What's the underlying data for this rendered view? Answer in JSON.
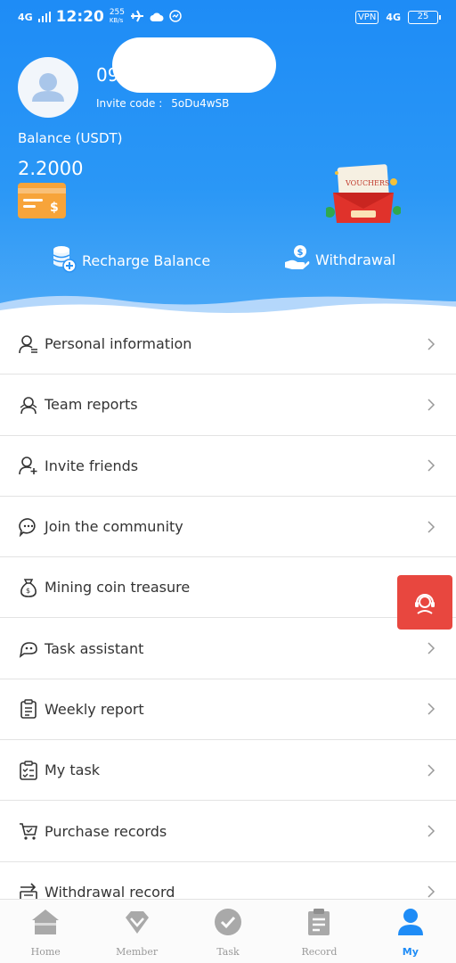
{
  "status_bar": {
    "network": "4G",
    "time": "12:20",
    "speed": "255",
    "speed_unit": "KB/s",
    "vpn": "VPN",
    "network_right": "4G",
    "battery": "25"
  },
  "profile": {
    "username": "09",
    "invite_label": "Invite code :",
    "invite_code": "5oDu4wSB"
  },
  "balance": {
    "label": "Balance (USDT)",
    "value": "2.2000"
  },
  "voucher": {
    "label": "VOUCHERS"
  },
  "actions": {
    "recharge": "Recharge Balance",
    "withdraw": "Withdrawal"
  },
  "menu": {
    "items": [
      {
        "label": "Personal information",
        "icon": "person-info-icon"
      },
      {
        "label": "Team reports",
        "icon": "team-icon"
      },
      {
        "label": "Invite friends",
        "icon": "add-user-icon"
      },
      {
        "label": "Join the community",
        "icon": "chat-icon"
      },
      {
        "label": "Mining coin treasure",
        "icon": "money-bag-icon"
      },
      {
        "label": "Task assistant",
        "icon": "assistant-icon"
      },
      {
        "label": "Weekly report",
        "icon": "report-icon"
      },
      {
        "label": "My task",
        "icon": "checklist-icon"
      },
      {
        "label": "Purchase records",
        "icon": "cart-icon"
      },
      {
        "label": "Withdrawal record",
        "icon": "withdraw-record-icon"
      }
    ]
  },
  "nav": {
    "items": [
      {
        "label": "Home",
        "icon": "home-icon",
        "active": false
      },
      {
        "label": "Member",
        "icon": "diamond-icon",
        "active": false
      },
      {
        "label": "Task",
        "icon": "task-check-icon",
        "active": false
      },
      {
        "label": "Record",
        "icon": "clipboard-icon",
        "active": false
      },
      {
        "label": "My",
        "icon": "user-icon",
        "active": true
      }
    ]
  },
  "colors": {
    "primary": "#1e8cf6",
    "float_button": "#e8473f",
    "wallet": "#f7a43a",
    "inactive_nav": "#999999"
  }
}
